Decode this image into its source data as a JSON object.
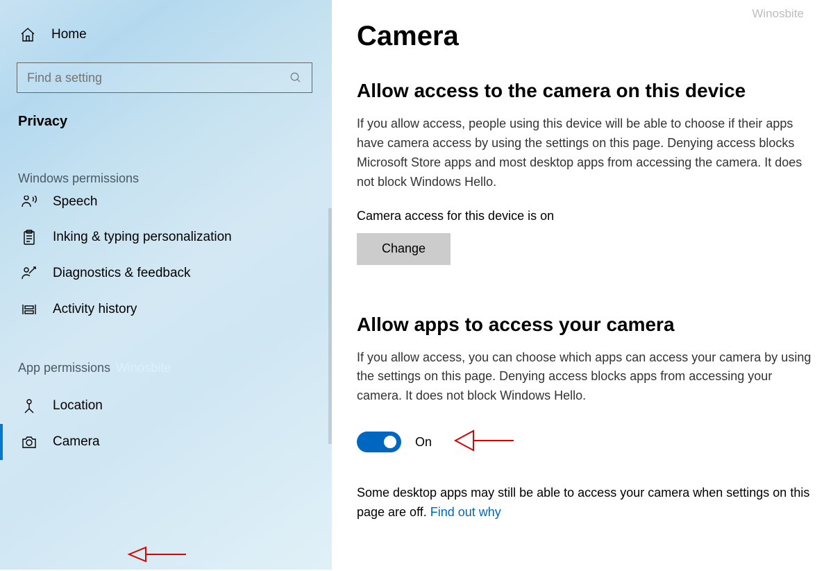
{
  "watermark": "Winosbite",
  "sidebar": {
    "home": "Home",
    "search_placeholder": "Find a setting",
    "section": "Privacy",
    "group1_label": "Windows permissions",
    "group2_label": "App permissions",
    "items_win": [
      {
        "label": "Speech"
      },
      {
        "label": "Inking & typing personalization"
      },
      {
        "label": "Diagnostics & feedback"
      },
      {
        "label": "Activity history"
      }
    ],
    "items_app": [
      {
        "label": "Location"
      },
      {
        "label": "Camera"
      }
    ]
  },
  "main": {
    "title": "Camera",
    "section1": {
      "heading": "Allow access to the camera on this device",
      "body": "If you allow access, people using this device will be able to choose if their apps have camera access by using the settings on this page. Denying access blocks Microsoft Store apps and most desktop apps from accessing the camera. It does not block Windows Hello.",
      "status": "Camera access for this device is on",
      "button": "Change"
    },
    "section2": {
      "heading": "Allow apps to access your camera",
      "body": "If you allow access, you can choose which apps can access your camera by using the settings on this page. Denying access blocks apps from accessing your camera. It does not block Windows Hello.",
      "toggle_state": "On",
      "note_prefix": "Some desktop apps may still be able to access your camera when settings on this page are off. ",
      "note_link": "Find out why"
    }
  }
}
